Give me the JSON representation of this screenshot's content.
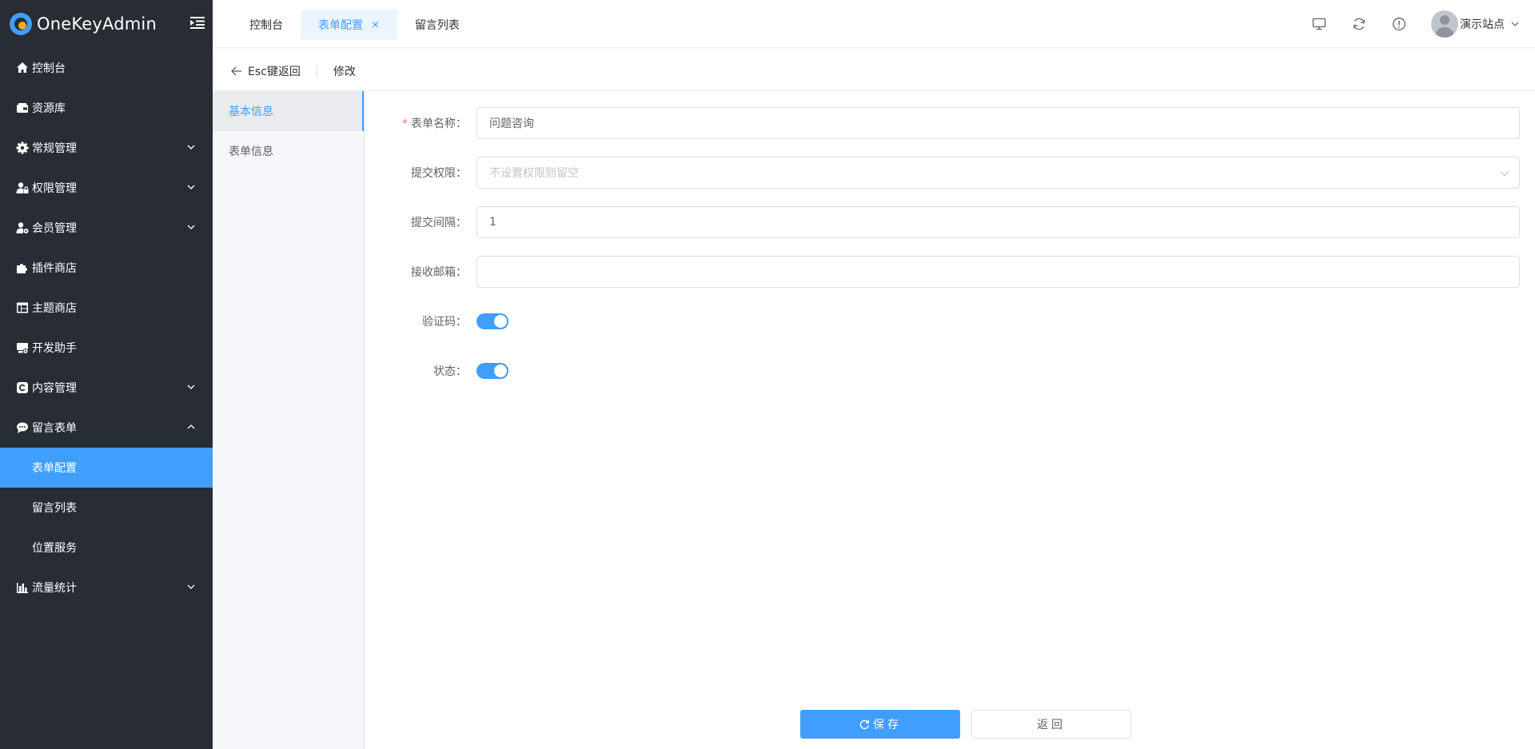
{
  "brand": {
    "name": "OneKeyAdmin"
  },
  "sidebar": {
    "items": [
      {
        "label": "控制台",
        "icon": "home-icon"
      },
      {
        "label": "资源库",
        "icon": "wallet-icon"
      },
      {
        "label": "常规管理",
        "icon": "gear-icon",
        "expandable": true
      },
      {
        "label": "权限管理",
        "icon": "user-lock-icon",
        "expandable": true
      },
      {
        "label": "会员管理",
        "icon": "user-gear-icon",
        "expandable": true
      },
      {
        "label": "插件商店",
        "icon": "puzzle-icon"
      },
      {
        "label": "主题商店",
        "icon": "layout-icon"
      },
      {
        "label": "开发助手",
        "icon": "dev-icon"
      },
      {
        "label": "内容管理",
        "icon": "copyright-icon",
        "expandable": true
      },
      {
        "label": "留言表单",
        "icon": "comment-icon",
        "expanded": true
      },
      {
        "label": "流量统计",
        "icon": "bar-chart-icon",
        "expandable": true
      }
    ],
    "sub_items": [
      {
        "label": "表单配置",
        "active": true
      },
      {
        "label": "留言列表"
      },
      {
        "label": "位置服务"
      }
    ]
  },
  "topbar": {
    "tabs": [
      {
        "label": "控制台"
      },
      {
        "label": "表单配置",
        "active": true,
        "close": "×"
      },
      {
        "label": "留言列表"
      }
    ],
    "user_name": "演示站点"
  },
  "subheader": {
    "back_label": "Esc键返回",
    "title": "修改"
  },
  "leftnav": {
    "items": [
      {
        "label": "基本信息",
        "active": true
      },
      {
        "label": "表单信息"
      }
    ]
  },
  "form": {
    "name": {
      "label": "表单名称：",
      "required_mark": "*",
      "value": "问题咨询"
    },
    "permission": {
      "label": "提交权限：",
      "placeholder": "不设置权限则留空"
    },
    "interval": {
      "label": "提交间隔：",
      "value": "1"
    },
    "email": {
      "label": "接收邮箱：",
      "value": ""
    },
    "captcha": {
      "label": "验证码：",
      "enabled": true
    },
    "status": {
      "label": "状态：",
      "enabled": true
    }
  },
  "buttons": {
    "save": "保存",
    "back": "返回"
  },
  "colors": {
    "primary": "#409eff",
    "sidebar_bg": "#282c34",
    "danger": "#f56c6c"
  }
}
